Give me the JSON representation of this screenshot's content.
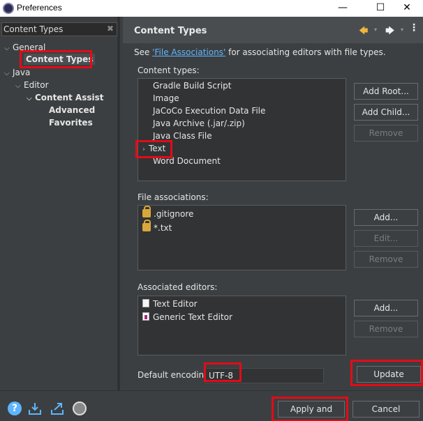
{
  "window": {
    "title": "Preferences",
    "minimize": "—",
    "maximize": "☐",
    "close": "✕"
  },
  "left": {
    "filter_value": "Content Types",
    "tree": {
      "general": "General",
      "content_types": "Content Types",
      "java": "Java",
      "editor": "Editor",
      "content_assist": "Content Assist",
      "advanced": "Advanced",
      "favorites": "Favorites"
    }
  },
  "page": {
    "title": "Content Types",
    "see_prefix": "See ",
    "see_link": "'File Associations'",
    "see_suffix": " for associating editors with file types.",
    "content_types_label": "Content types:",
    "content_types": [
      "Gradle Build Script",
      "Image",
      "JaCoCo Execution Data File",
      "Java Archive (.jar/.zip)",
      "Java Class File",
      "Text",
      "Word Document"
    ],
    "file_assoc_label": "File associations:",
    "file_associations": [
      ".gitignore",
      "*.txt"
    ],
    "assoc_editors_label": "Associated editors:",
    "editors": [
      "Text Editor",
      "Generic Text Editor"
    ],
    "encoding_label": "Default encoding:",
    "encoding_value": "UTF-8"
  },
  "buttons": {
    "add_root": "Add Root...",
    "add_child": "Add Child...",
    "remove": "Remove",
    "add": "Add...",
    "edit": "Edit...",
    "update": "Update",
    "apply_close": "Apply and Close",
    "cancel": "Cancel"
  },
  "icons": {
    "help": "?",
    "back": "🡄",
    "forward": "🡆",
    "menu": "⋮",
    "dropdown": "▾"
  },
  "colors": {
    "highlight": "#e30b17",
    "link": "#5eb6ff"
  }
}
